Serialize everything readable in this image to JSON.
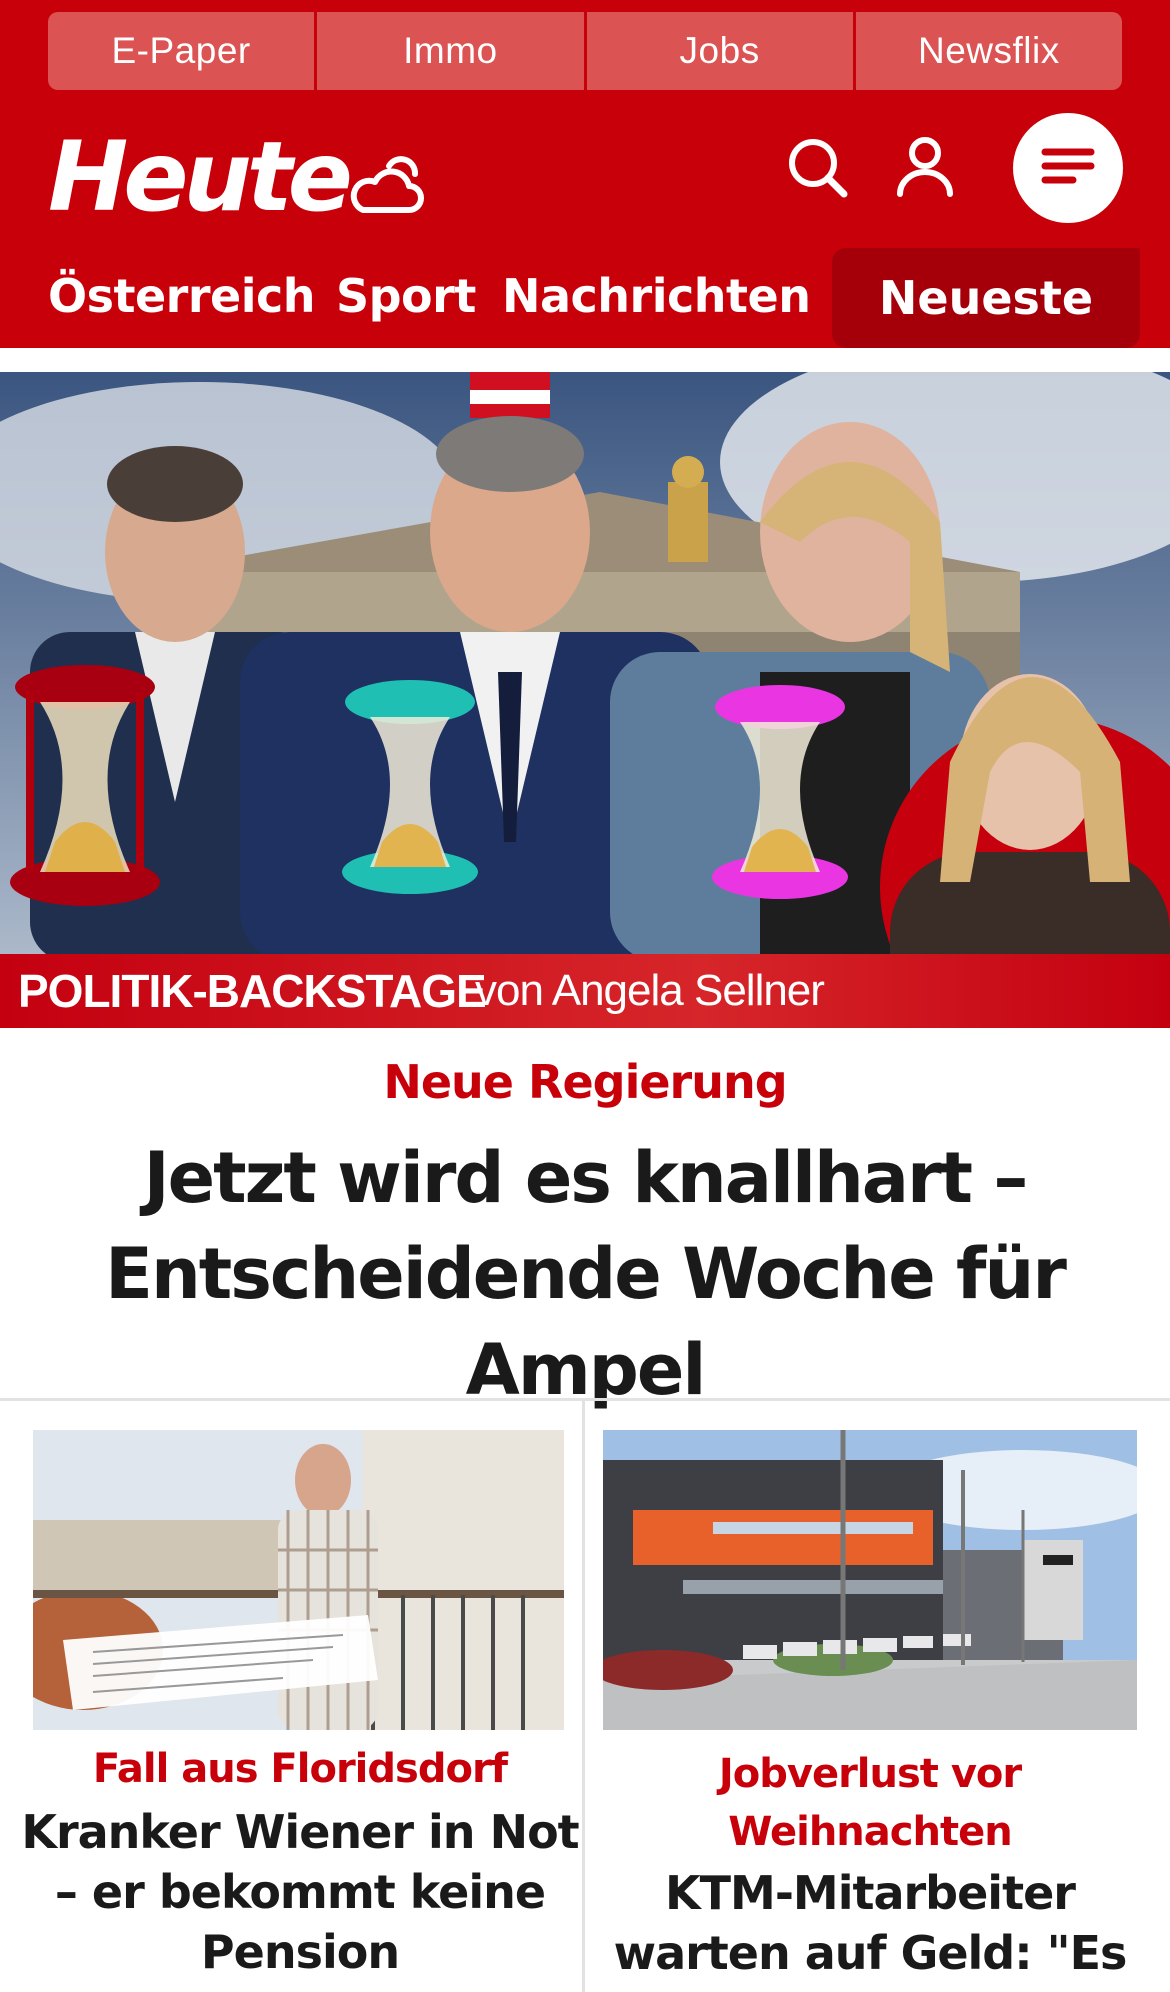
{
  "topnav": {
    "items": [
      {
        "label": "E-Paper"
      },
      {
        "label": "Immo"
      },
      {
        "label": "Jobs"
      },
      {
        "label": "Newsflix"
      }
    ]
  },
  "brand": {
    "logo_text": "Heute",
    "weather_icon": "cloud-sun-icon",
    "color_primary": "#c8000a",
    "color_dark": "#a5000a"
  },
  "header_icons": {
    "search": "search-icon",
    "account": "user-icon",
    "menu": "hamburger-menu-icon"
  },
  "section_nav": {
    "items": [
      {
        "label": "Österreich"
      },
      {
        "label": "Sport"
      },
      {
        "label": "Nachrichten"
      }
    ],
    "active_label": "Neueste"
  },
  "hero": {
    "banner_bold": "POLITIK-BACKSTAGE",
    "banner_rest": "von Angela Sellner",
    "kicker": "Neue Regierung",
    "headline_line1": "Jetzt wird es knallhart –",
    "headline_line2": "Entscheidende Woche für Ampel"
  },
  "cards": [
    {
      "kicker": "Fall aus Floridsdorf",
      "title_line1": "Kranker Wiener in Not",
      "title_line2": "– er bekommt keine",
      "title_line3": "Pension"
    },
    {
      "kicker_line1": "Jobverlust vor",
      "kicker_line2": "Weihnachten",
      "title_line1": "KTM-Mitarbeiter",
      "title_line2": "warten auf Geld: \"Es"
    }
  ]
}
